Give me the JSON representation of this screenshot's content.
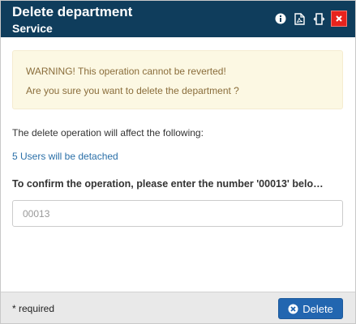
{
  "dialog": {
    "title": "Delete department",
    "subtitle": "Service",
    "header_icons": [
      "info-icon",
      "pdf-icon",
      "resize-icon",
      "close-icon"
    ]
  },
  "warning": {
    "line1": "WARNING! This operation cannot be reverted!",
    "line2": "Are you sure you want to delete the department ?"
  },
  "affect": {
    "intro": "The delete operation will affect the following:",
    "users_link": "5 Users will be detached"
  },
  "confirm": {
    "label": "To confirm the operation, please enter the number '00013' belo…",
    "placeholder": "00013",
    "value": ""
  },
  "footer": {
    "required_note": "* required",
    "delete_label": "Delete"
  },
  "colors": {
    "header_bg": "#0f3d5c",
    "warning_bg": "#fcf8e3",
    "warning_text": "#8a6d3b",
    "link": "#2a6fa8",
    "close_bg": "#e8231d",
    "primary_button": "#2266b0"
  }
}
